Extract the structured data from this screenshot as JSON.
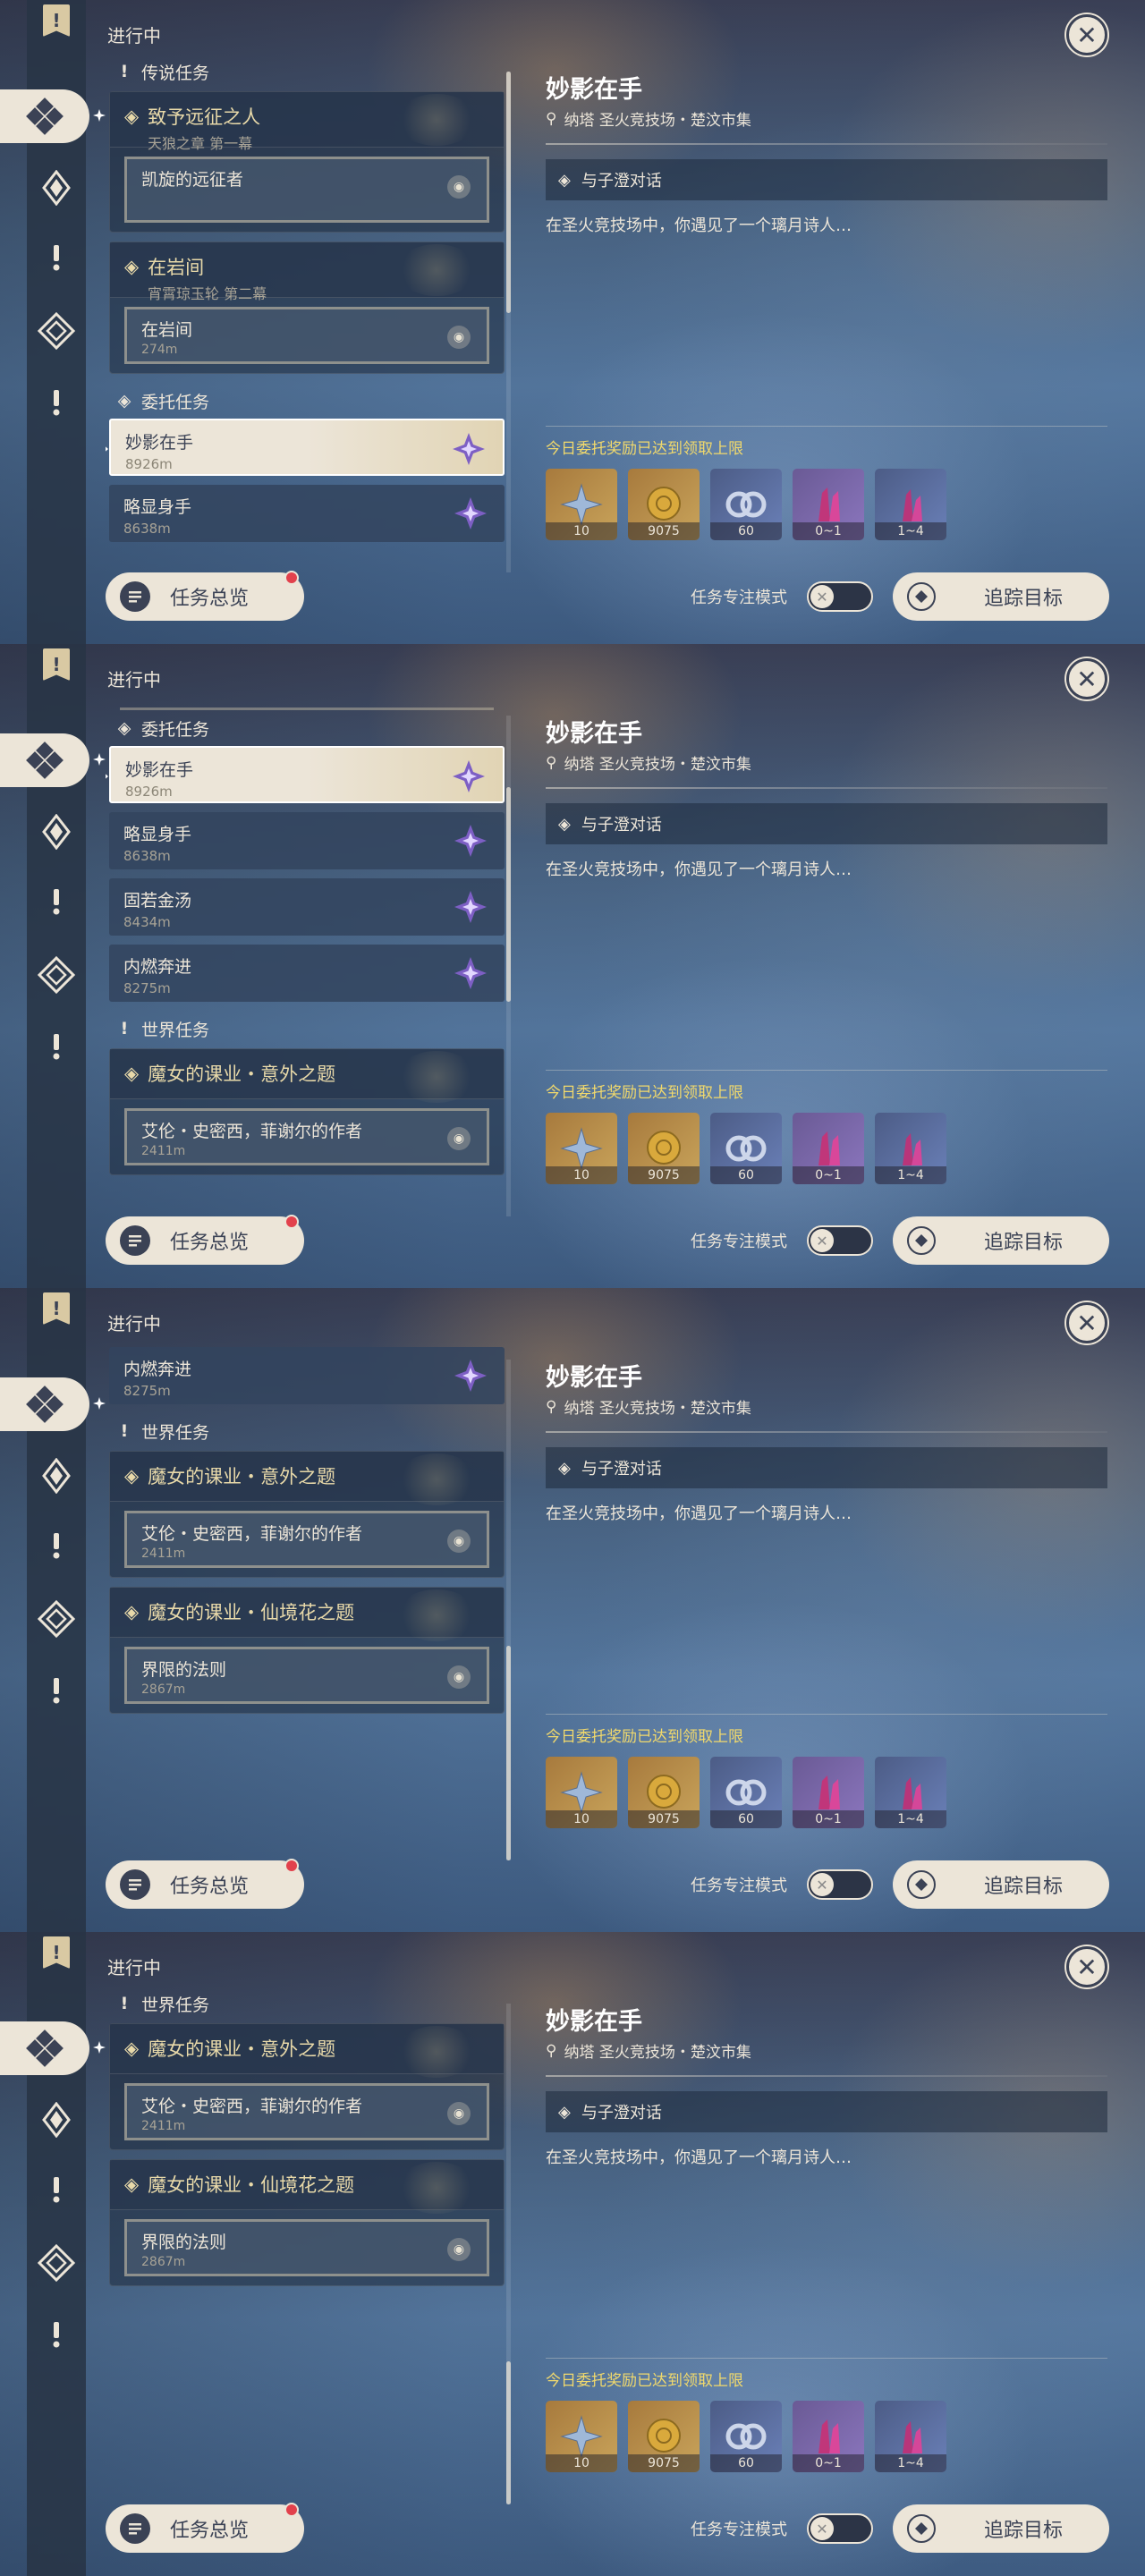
{
  "list_title": "进行中",
  "sidebar_flag": "!",
  "categories": {
    "legend": "传说任务",
    "commission": "委托任务",
    "world": "世界任务"
  },
  "quests": {
    "legend1": {
      "title": "致予远征之人",
      "sub": "天狼之章 第一幕",
      "step": "凯旋的远征者",
      "dist": ""
    },
    "legend2": {
      "title": "在岩间",
      "sub": "宵霄琼玉轮 第二幕",
      "step": "在岩间",
      "dist": "274m"
    },
    "world1": {
      "title": "魔女的课业・意外之题",
      "step": "艾伦・史密西，菲谢尔的作者",
      "dist": "2411m"
    },
    "world2": {
      "title": "魔女的课业・仙境花之题",
      "step": "界限的法则",
      "dist": "2867m"
    }
  },
  "commissions": [
    {
      "title": "妙影在手",
      "dist": "8926m"
    },
    {
      "title": "略显身手",
      "dist": "8638m"
    },
    {
      "title": "固若金汤",
      "dist": "8434m"
    },
    {
      "title": "内燃奔进",
      "dist": "8275m"
    }
  ],
  "detail": {
    "title": "妙影在手",
    "location": "纳塔  圣火竞技场・楚汶市集",
    "step": "与子澄对话",
    "desc": "在圣火竞技场中，你遇见了一个璃月诗人…",
    "note": "今日委托奖励已达到领取上限",
    "rewards": [
      {
        "icon": "adventure-exp-icon",
        "count": "10"
      },
      {
        "icon": "mora-icon",
        "count": "9075"
      },
      {
        "icon": "friendship-exp-icon",
        "count": "60"
      },
      {
        "icon": "crystal-icon",
        "count": "0~1"
      },
      {
        "icon": "crystal-chunk-icon",
        "count": "1~4"
      }
    ]
  },
  "buttons": {
    "overview": "任务总览",
    "focus": "任务专注模式",
    "track": "追踪目标",
    "close": "✕"
  },
  "colors": {
    "cream": "#ece5d8",
    "dark": "#3b4255",
    "gold_text": "#f1d96c",
    "badge": "#e2414c"
  }
}
